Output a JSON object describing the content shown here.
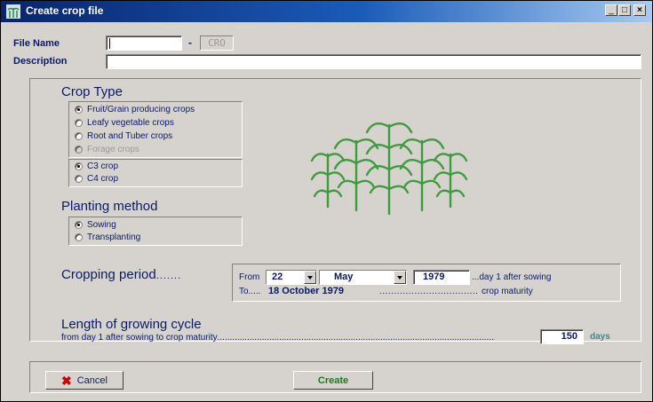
{
  "window": {
    "title": "Create crop file",
    "controls": {
      "minimize": "_",
      "maximize": "□",
      "close": "×"
    }
  },
  "file": {
    "name_label": "File Name",
    "name_value": "",
    "separator": "-",
    "extension": "CRO",
    "description_label": "Description",
    "description_value": ""
  },
  "crop_type": {
    "heading": "Crop Type",
    "options": [
      {
        "label": "Fruit/Grain producing crops",
        "selected": true,
        "enabled": true
      },
      {
        "label": "Leafy vegetable crops",
        "selected": false,
        "enabled": true
      },
      {
        "label": "Root and Tuber crops",
        "selected": false,
        "enabled": true
      },
      {
        "label": "Forage crops",
        "selected": false,
        "enabled": false
      }
    ],
    "pathway_options": [
      {
        "label": "C3 crop",
        "selected": true
      },
      {
        "label": "C4 crop",
        "selected": false
      }
    ],
    "image_icon": "crop-plants-icon"
  },
  "planting": {
    "heading": "Planting method",
    "options": [
      {
        "label": "Sowing",
        "selected": true
      },
      {
        "label": "Transplanting",
        "selected": false
      }
    ]
  },
  "cropping_period": {
    "heading": "Cropping period",
    "leader": ".......",
    "from_label": "From",
    "day": "22",
    "month": "May",
    "year": "1979",
    "from_suffix": "...day 1 after sowing",
    "to_label": "To.....",
    "to_date": "18 October 1979",
    "to_leader": "..................................",
    "to_suffix": "crop maturity"
  },
  "growing_cycle": {
    "heading": "Length of growing cycle",
    "description": "from day 1 after sowing to crop maturity",
    "leader": "..........................................................................................................................................................................",
    "value": "150",
    "unit": "days"
  },
  "buttons": {
    "cancel": "Cancel",
    "create": "Create"
  },
  "colors": {
    "label_text": "#0a1a6a",
    "plant_green": "#3f9b3f",
    "cancel_x": "#cc0000",
    "days_unit": "#2f8f8f"
  }
}
